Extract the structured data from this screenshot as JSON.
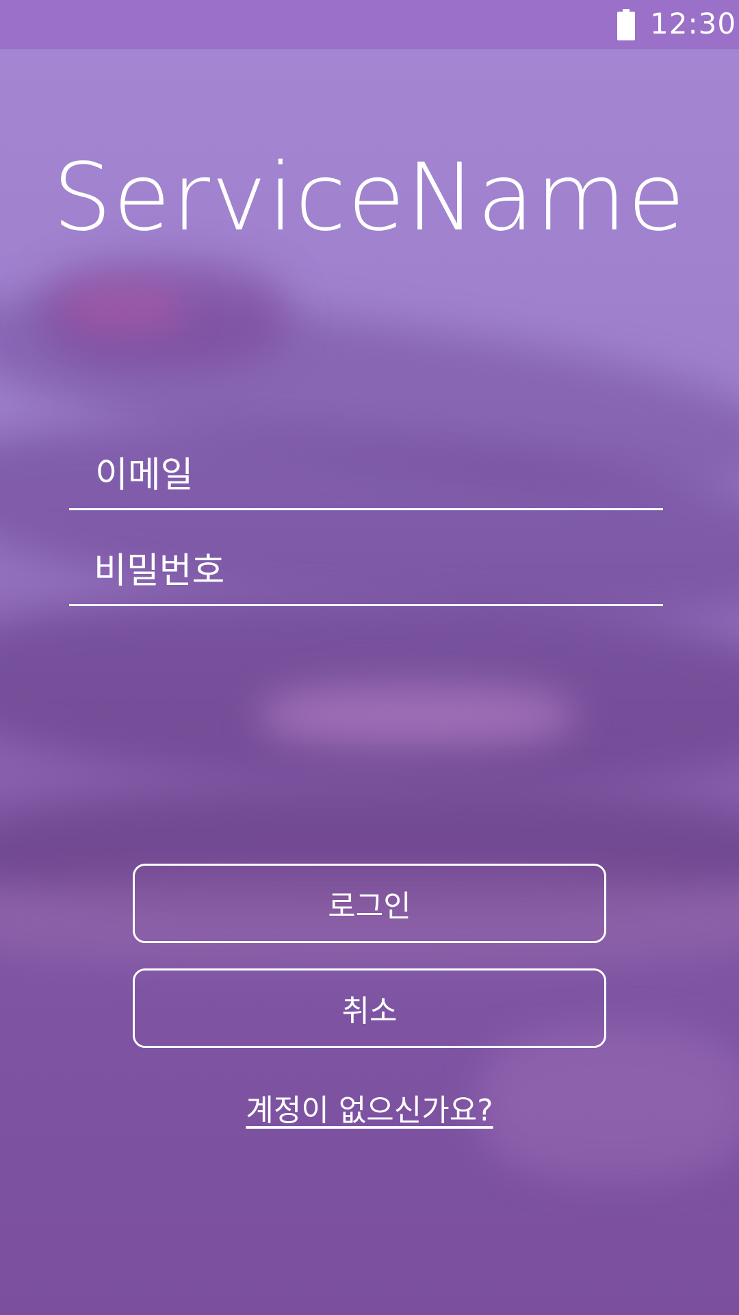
{
  "status_bar": {
    "time": "12:30",
    "battery_icon": "battery-icon"
  },
  "app": {
    "service_name": "ServiceName"
  },
  "login_form": {
    "email_placeholder": "이메일",
    "password_placeholder": "비밀번호",
    "login_label": "로그인",
    "cancel_label": "취소",
    "signup_link": "계정이 없으신가요?"
  },
  "colors": {
    "accent": "#9a70c8",
    "text": "#ffffff"
  }
}
